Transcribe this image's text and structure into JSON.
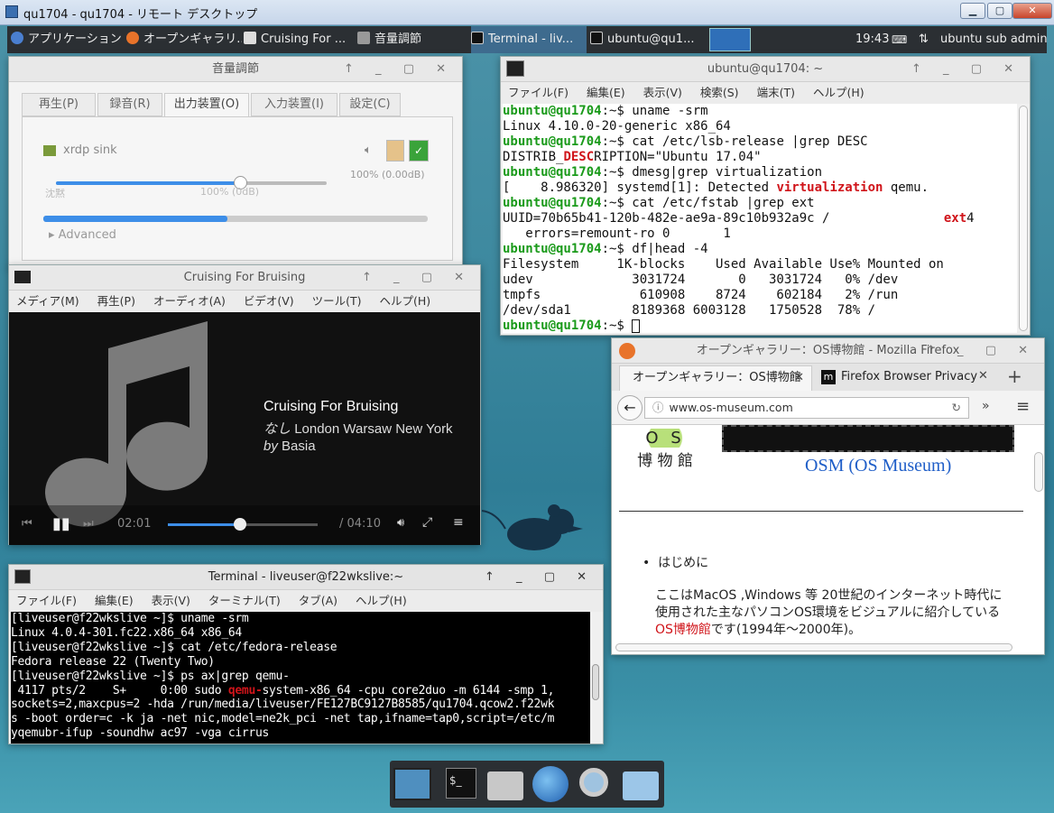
{
  "rdp": {
    "title": "qu1704 - qu1704 - リモート デスクトップ",
    "min": "▁",
    "max": "▢",
    "close": "✕"
  },
  "panel": {
    "apps": "アプリケーション",
    "tasks": [
      "オープンギャラリ...",
      "Cruising For ...",
      "音量調節",
      "Terminal - liv...",
      "ubuntu@qu1..."
    ],
    "clock": "19:43",
    "user": "ubuntu sub admin"
  },
  "volume": {
    "title": "音量調節",
    "tabs": [
      "再生(P)",
      "録音(R)",
      "出力装置(O)",
      "入力装置(I)",
      "設定(C)"
    ],
    "device": "xrdp sink",
    "percent": "100% (0.00dB)",
    "silence": "沈黙",
    "mark": "100% (0dB)",
    "advanced": "Advanced",
    "slider_value": 0.68
  },
  "player": {
    "title": "Cruising For Bruising",
    "menu": [
      "メディア(M)",
      "再生(P)",
      "オーディオ(A)",
      "ビデオ(V)",
      "ツール(T)",
      "ヘルプ(H)"
    ],
    "track": "Cruising For Bruising",
    "album_prefix": "なし",
    "album": "London Warsaw New York",
    "artist_prefix": "by",
    "artist": "Basia",
    "elapsed": "02:01",
    "duration": "/ 04:10",
    "progress": 0.48
  },
  "uterm": {
    "title": "ubuntu@qu1704: ~",
    "menu": [
      "ファイル(F)",
      "編集(E)",
      "表示(V)",
      "検索(S)",
      "端末(T)",
      "ヘルプ(H)"
    ],
    "prompt": "ubuntu@qu1704",
    "lines": [
      {
        "p": true,
        "t": ":~$ uname -srm"
      },
      {
        "t": "Linux 4.10.0-20-generic x86_64"
      },
      {
        "p": true,
        "t": ":~$ cat /etc/lsb-release |grep DESC"
      },
      {
        "pre": "DISTRIB_",
        "hl": "DESC",
        "post": "RIPTION=\"Ubuntu 17.04\""
      },
      {
        "p": true,
        "t": ":~$ dmesg|grep virtualization"
      },
      {
        "pre": "[    8.986320] systemd[1]: Detected ",
        "hl": "virtualization",
        "post": " qemu."
      },
      {
        "p": true,
        "t": ":~$ cat /etc/fstab |grep ext"
      },
      {
        "pre": "UUID=70b65b41-120b-482e-ae9a-89c10b932a9c /               ",
        "hl": "ext",
        "post": "4"
      },
      {
        "t": "   errors=remount-ro 0       1"
      },
      {
        "p": true,
        "t": ":~$ df|head -4"
      },
      {
        "t": "Filesystem     1K-blocks    Used Available Use% Mounted on"
      },
      {
        "t": "udev             3031724       0   3031724   0% /dev"
      },
      {
        "t": "tmpfs             610908    8724    602184   2% /run"
      },
      {
        "t": "/dev/sda1        8189368 6003128   1750528  78% /"
      },
      {
        "p": true,
        "t": ":~$ "
      }
    ]
  },
  "firefox": {
    "title": "オープンギャラリー：OS博物館 - Mozilla Firefox",
    "tab1": "オープンギャラリー：OS博物館",
    "tab2": "Firefox Browser Privacy",
    "url": "www.os-museum.com",
    "logo_os": "O S",
    "logo_kan": "博 物 館",
    "banner": "OSM (OS Museum)",
    "bullet": "はじめに",
    "p1": "ここはMacOS ,Windows 等 20世紀のインターネット時代に",
    "p2": "使用された主なパソコンOS環境をビジュアルに紹介している",
    "link": "OS博物館",
    "p3": "です(1994年〜2000年)。"
  },
  "fterm": {
    "title": "Terminal - liveuser@f22wkslive:~",
    "menu": [
      "ファイル(F)",
      "編集(E)",
      "表示(V)",
      "ターミナル(T)",
      "タブ(A)",
      "ヘルプ(H)"
    ],
    "lines": [
      {
        "t": "[liveuser@f22wkslive ~]$ uname -srm"
      },
      {
        "t": "Linux 4.0.4-301.fc22.x86_64 x86_64"
      },
      {
        "t": "[liveuser@f22wkslive ~]$ cat /etc/fedora-release"
      },
      {
        "t": "Fedora release 22 (Twenty Two)"
      },
      {
        "t": "[liveuser@f22wkslive ~]$ ps ax|grep qemu-"
      },
      {
        "pre": " 4117 pts/2    S+     0:00 sudo ",
        "hl": "qemu-",
        "post": "system-x86_64 -cpu core2duo -m 6144 -smp 1,"
      },
      {
        "t": "sockets=2,maxcpus=2 -hda /run/media/liveuser/FE127BC9127B8585/qu1704.qcow2.f22wk"
      },
      {
        "t": "s -boot order=c -k ja -net nic,model=ne2k_pci -net tap,ifname=tap0,script=/etc/m"
      },
      {
        "t": "yqemubr-ifup -soundhw ac97 -vga cirrus"
      }
    ]
  },
  "colors": {
    "prompt": "#1a9a1a",
    "highlight": "#d0141a",
    "accent": "#3d8ee8"
  }
}
